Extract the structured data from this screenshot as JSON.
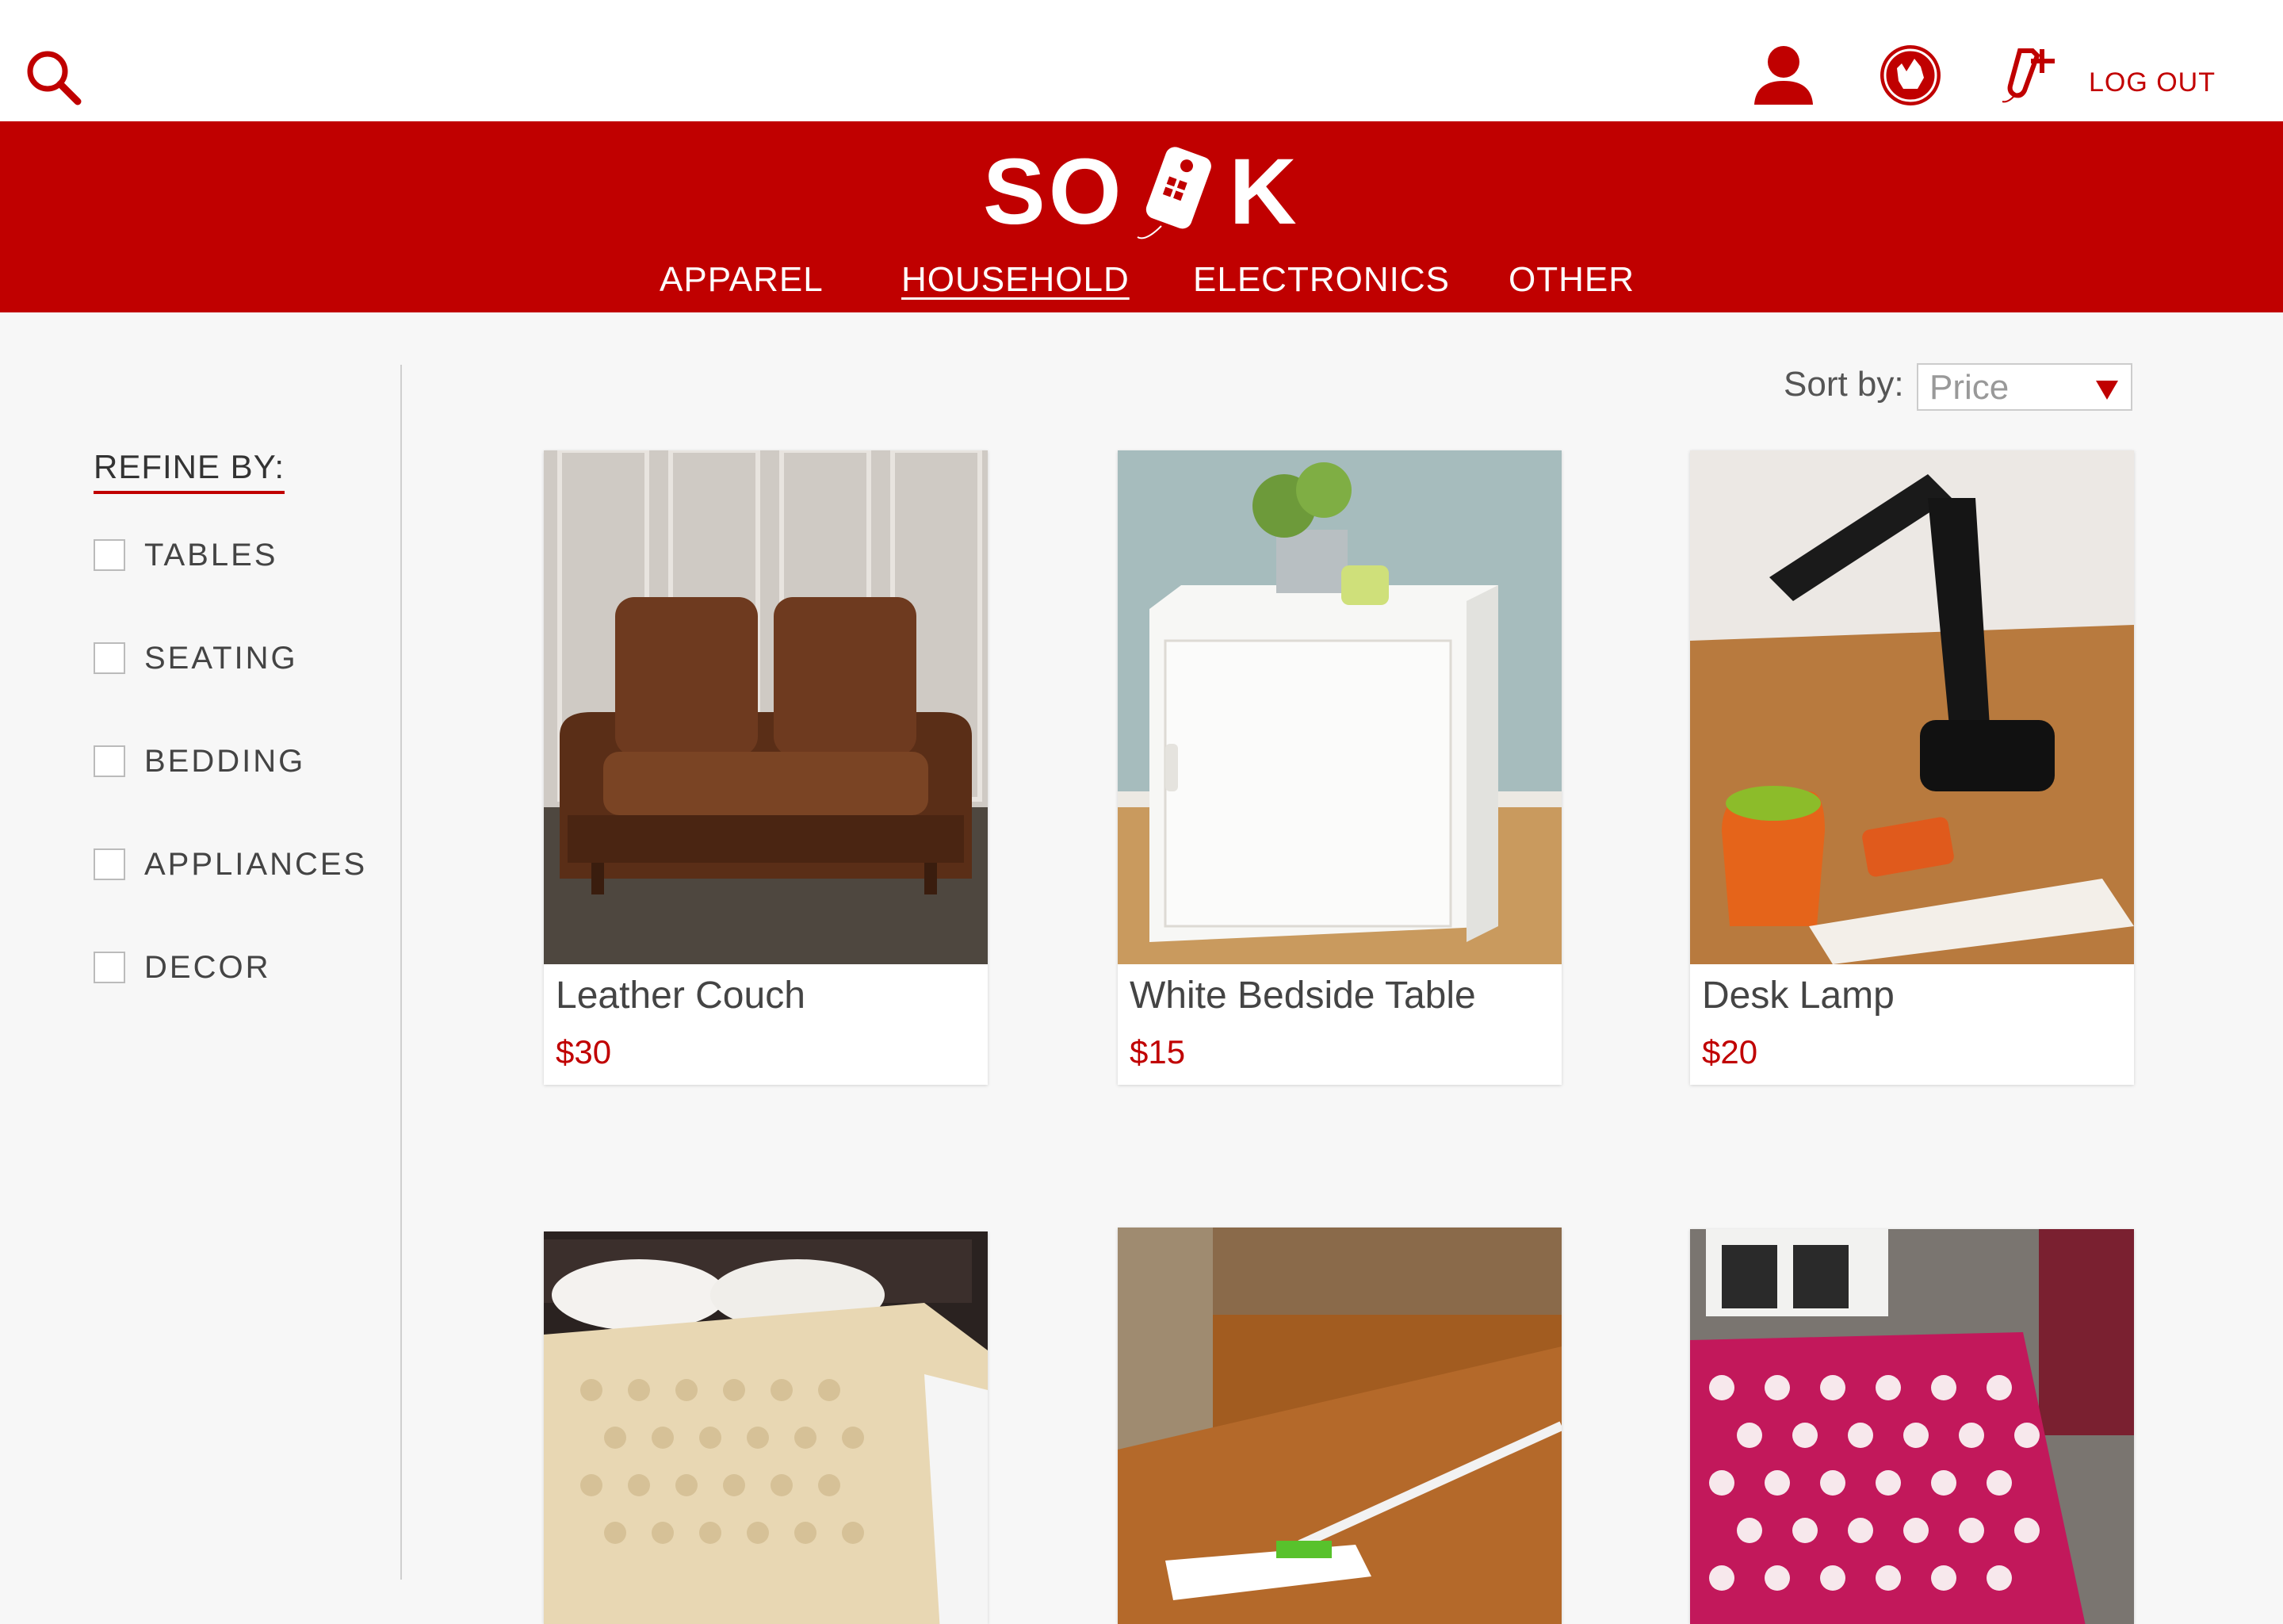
{
  "topbar": {
    "logout_label": "LOG OUT",
    "icons": [
      "search-icon",
      "profile-icon",
      "cart-icon",
      "add-listing-icon"
    ]
  },
  "header": {
    "logo_left": "SO",
    "logo_right": "K",
    "nav": [
      {
        "label": "APPAREL",
        "active": false
      },
      {
        "label": "HOUSEHOLD",
        "active": true
      },
      {
        "label": "ELECTRONICS",
        "active": false
      },
      {
        "label": "OTHER",
        "active": false
      }
    ]
  },
  "sidebar": {
    "title": "REFINE BY:",
    "filters": [
      {
        "label": "TABLES",
        "checked": false
      },
      {
        "label": "SEATING",
        "checked": false
      },
      {
        "label": "BEDDING",
        "checked": false
      },
      {
        "label": "APPLIANCES",
        "checked": false
      },
      {
        "label": "DECOR",
        "checked": false
      }
    ]
  },
  "sort": {
    "label": "Sort by:",
    "value": "Price"
  },
  "products": [
    {
      "name": "Leather Couch",
      "price": "$30"
    },
    {
      "name": "White Bedside Table",
      "price": "$15"
    },
    {
      "name": "Desk Lamp",
      "price": "$20"
    },
    {
      "name": "",
      "price": ""
    },
    {
      "name": "",
      "price": ""
    },
    {
      "name": "",
      "price": ""
    }
  ],
  "colors": {
    "brand_red": "#c00000",
    "background": "#f7f7f7"
  }
}
